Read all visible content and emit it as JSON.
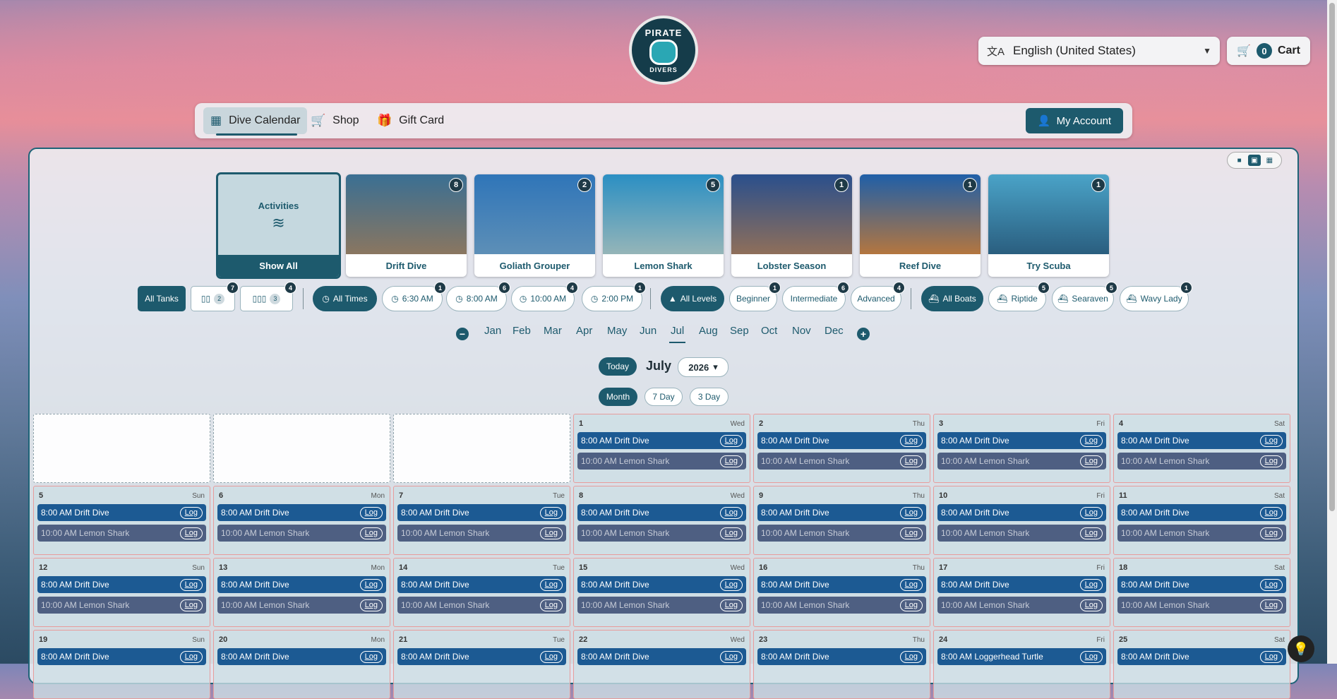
{
  "header": {
    "logo_top": "PIRATE",
    "logo_bottom": "DIVERS",
    "language": "English (United States)",
    "cart_count": "0",
    "cart_label": "Cart"
  },
  "nav": {
    "items": [
      {
        "label": "Dive Calendar",
        "icon": "calendar-icon"
      },
      {
        "label": "Shop",
        "icon": "cart-icon"
      },
      {
        "label": "Gift Card",
        "icon": "gift-icon"
      }
    ],
    "account_label": "My Account"
  },
  "activities": {
    "all_title": "Activities",
    "all_button": "Show All",
    "items": [
      {
        "label": "Drift Dive",
        "count": "8",
        "color_top": "#3a6f93",
        "color_bottom": "#8a7660"
      },
      {
        "label": "Goliath Grouper",
        "count": "2",
        "color_top": "#2f75b8",
        "color_bottom": "#5d8fb7"
      },
      {
        "label": "Lemon Shark",
        "count": "5",
        "color_top": "#2b8fc3",
        "color_bottom": "#95b5b8"
      },
      {
        "label": "Lobster Season",
        "count": "1",
        "color_top": "#2a4f8c",
        "color_bottom": "#8f6f5a"
      },
      {
        "label": "Reef Dive",
        "count": "1",
        "color_top": "#1f5fa8",
        "color_bottom": "#b4763f"
      },
      {
        "label": "Try Scuba",
        "count": "1",
        "color_top": "#4aa3c8",
        "color_bottom": "#2a5e7f"
      }
    ]
  },
  "filters": {
    "tanks": {
      "all": "All Tanks",
      "options": [
        {
          "count": "2",
          "badge": "7"
        },
        {
          "count": "3",
          "badge": "4"
        }
      ]
    },
    "times": {
      "all": "All Times",
      "options": [
        {
          "label": "6:30 AM",
          "badge": "1"
        },
        {
          "label": "8:00 AM",
          "badge": "6"
        },
        {
          "label": "10:00 AM",
          "badge": "4"
        },
        {
          "label": "2:00 PM",
          "badge": "1"
        }
      ]
    },
    "levels": {
      "all": "All Levels",
      "options": [
        {
          "label": "Beginner",
          "badge": "1"
        },
        {
          "label": "Intermediate",
          "badge": "6"
        },
        {
          "label": "Advanced",
          "badge": "4"
        }
      ]
    },
    "boats": {
      "all": "All Boats",
      "options": [
        {
          "label": "Riptide",
          "badge": "5"
        },
        {
          "label": "Searaven",
          "badge": "5"
        },
        {
          "label": "Wavy Lady",
          "badge": "1"
        }
      ]
    }
  },
  "months": [
    "Jan",
    "Feb",
    "Mar",
    "Apr",
    "May",
    "Jun",
    "Jul",
    "Aug",
    "Sep",
    "Oct",
    "Nov",
    "Dec"
  ],
  "calendar": {
    "today_label": "Today",
    "month": "July",
    "year": "2026",
    "views": [
      "Month",
      "7 Day",
      "3 Day"
    ],
    "log_label": "Log",
    "days": [
      {
        "num": "1",
        "dow": "Wed",
        "e1": "8:00 AM Drift Dive",
        "e2": "10:00 AM Lemon Shark"
      },
      {
        "num": "2",
        "dow": "Thu",
        "e1": "8:00 AM Drift Dive",
        "e2": "10:00 AM Lemon Shark"
      },
      {
        "num": "3",
        "dow": "Fri",
        "e1": "8:00 AM Drift Dive",
        "e2": "10:00 AM Lemon Shark"
      },
      {
        "num": "4",
        "dow": "Sat",
        "e1": "8:00 AM Drift Dive",
        "e2": "10:00 AM Lemon Shark"
      },
      {
        "num": "5",
        "dow": "Sun",
        "e1": "8:00 AM Drift Dive",
        "e2": "10:00 AM Lemon Shark"
      },
      {
        "num": "6",
        "dow": "Mon",
        "e1": "8:00 AM Drift Dive",
        "e2": "10:00 AM Lemon Shark"
      },
      {
        "num": "7",
        "dow": "Tue",
        "e1": "8:00 AM Drift Dive",
        "e2": "10:00 AM Lemon Shark"
      },
      {
        "num": "8",
        "dow": "Wed",
        "e1": "8:00 AM Drift Dive",
        "e2": "10:00 AM Lemon Shark"
      },
      {
        "num": "9",
        "dow": "Thu",
        "e1": "8:00 AM Drift Dive",
        "e2": "10:00 AM Lemon Shark"
      },
      {
        "num": "10",
        "dow": "Fri",
        "e1": "8:00 AM Drift Dive",
        "e2": "10:00 AM Lemon Shark"
      },
      {
        "num": "11",
        "dow": "Sat",
        "e1": "8:00 AM Drift Dive",
        "e2": "10:00 AM Lemon Shark"
      },
      {
        "num": "12",
        "dow": "Sun",
        "e1": "8:00 AM Drift Dive",
        "e2": "10:00 AM Lemon Shark"
      },
      {
        "num": "13",
        "dow": "Mon",
        "e1": "8:00 AM Drift Dive",
        "e2": "10:00 AM Lemon Shark"
      },
      {
        "num": "14",
        "dow": "Tue",
        "e1": "8:00 AM Drift Dive",
        "e2": "10:00 AM Lemon Shark"
      },
      {
        "num": "15",
        "dow": "Wed",
        "e1": "8:00 AM Drift Dive",
        "e2": "10:00 AM Lemon Shark"
      },
      {
        "num": "16",
        "dow": "Thu",
        "e1": "8:00 AM Drift Dive",
        "e2": "10:00 AM Lemon Shark"
      },
      {
        "num": "17",
        "dow": "Fri",
        "e1": "8:00 AM Drift Dive",
        "e2": "10:00 AM Lemon Shark"
      },
      {
        "num": "18",
        "dow": "Sat",
        "e1": "8:00 AM Drift Dive",
        "e2": "10:00 AM Lemon Shark"
      },
      {
        "num": "19",
        "dow": "Sun",
        "e1": "8:00 AM Drift Dive",
        "e2": ""
      },
      {
        "num": "20",
        "dow": "Mon",
        "e1": "8:00 AM Drift Dive",
        "e2": ""
      },
      {
        "num": "21",
        "dow": "Tue",
        "e1": "8:00 AM Drift Dive",
        "e2": ""
      },
      {
        "num": "22",
        "dow": "Wed",
        "e1": "8:00 AM Drift Dive",
        "e2": ""
      },
      {
        "num": "23",
        "dow": "Thu",
        "e1": "8:00 AM Drift Dive",
        "e2": ""
      },
      {
        "num": "24",
        "dow": "Fri",
        "e1": "8:00 AM Loggerhead Turtle",
        "e2": ""
      },
      {
        "num": "25",
        "dow": "Sat",
        "e1": "8:00 AM Drift Dive",
        "e2": ""
      }
    ]
  },
  "colors": {
    "brand": "#1d5a6d",
    "event_primary": "#1c5a93",
    "event_secondary": "#4e5f82"
  }
}
